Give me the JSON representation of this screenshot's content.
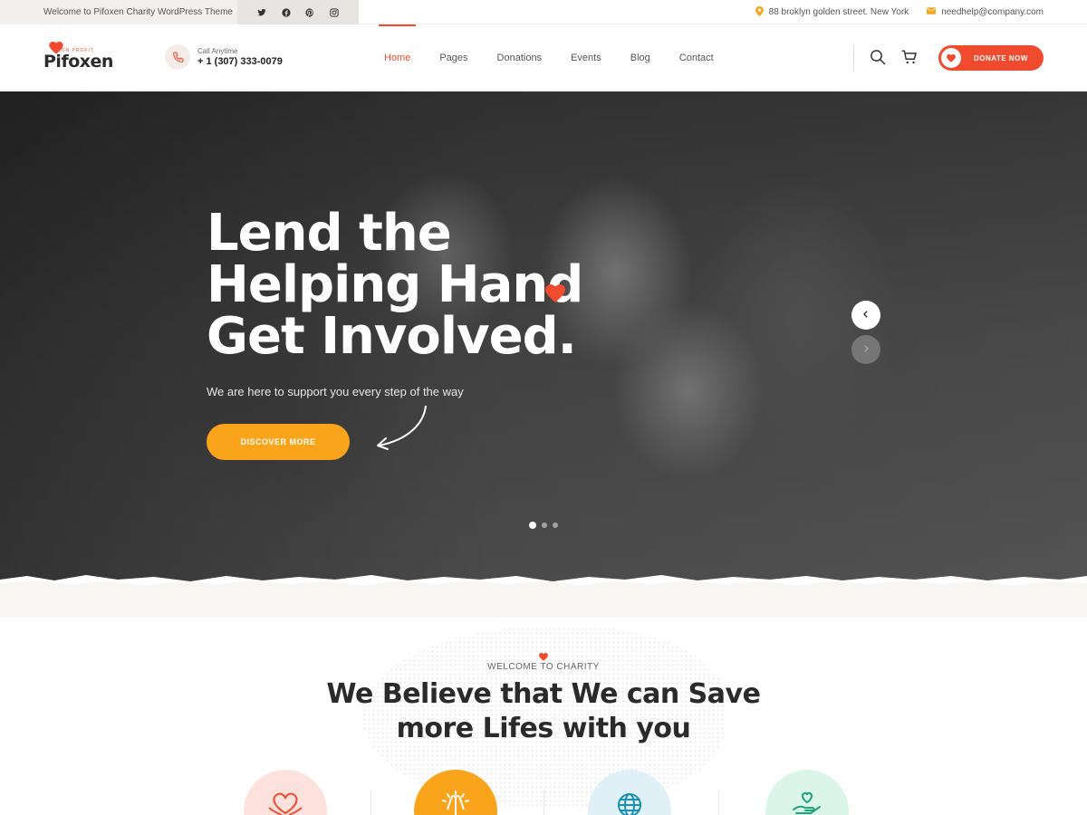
{
  "topbar": {
    "welcome": "Welcome to Pifoxen Charity WordPress Theme",
    "social": [
      "twitter-icon",
      "facebook-icon",
      "pinterest-icon",
      "instagram-icon"
    ],
    "address": "88 broklyn golden street. New York",
    "email": "needhelp@company.com"
  },
  "header": {
    "logo_text": "Pifoxen",
    "logo_small": "NON PROFIT",
    "call_label": "Call Anytime",
    "call_number": "+ 1 (307) 333-0079",
    "nav": [
      {
        "label": "Home",
        "active": true
      },
      {
        "label": "Pages",
        "active": false
      },
      {
        "label": "Donations",
        "active": false
      },
      {
        "label": "Events",
        "active": false
      },
      {
        "label": "Blog",
        "active": false
      },
      {
        "label": "Contact",
        "active": false
      }
    ],
    "donate_label": "DONATE NOW"
  },
  "hero": {
    "title_lines": [
      "Lend the",
      "Helping Hand",
      "Get Involved."
    ],
    "subtitle": "We are here to support you every step of the way",
    "button_label": "DISCOVER MORE",
    "slides": 3,
    "active_slide": 1
  },
  "welcome": {
    "tag": "WELCOME TO CHARITY",
    "title_lines": [
      "We Believe that We can Save",
      "more Lifes with you"
    ]
  },
  "colors": {
    "accent": "#f14b2f",
    "orange": "#f9a41b",
    "circle_1": "#fde1dc",
    "circle_2": "#f9a41b",
    "circle_3": "#dff0f7",
    "circle_4": "#dcf5ea"
  }
}
